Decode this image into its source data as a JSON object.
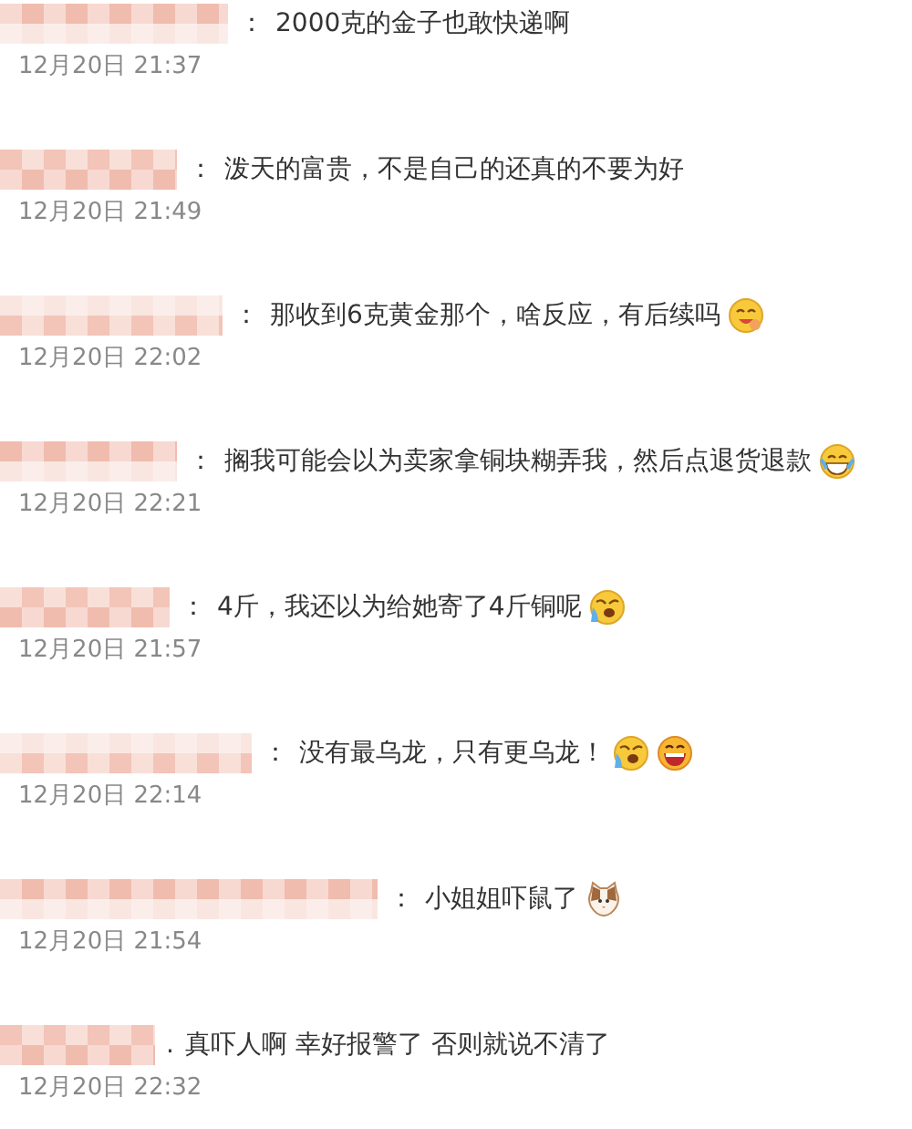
{
  "comments": [
    {
      "separator": "：",
      "text": "2000克的金子也敢快递啊",
      "time": "12月20日 21:37"
    },
    {
      "separator": "：",
      "text": "泼天的富贵，不是自己的还真的不要为好",
      "time": "12月20日 21:49"
    },
    {
      "separator": "：",
      "text": "那收到6克黄金那个，啥反应，有后续吗",
      "emojis": [
        {
          "kind": "yummy"
        }
      ],
      "time": "12月20日 22:02"
    },
    {
      "separator": "：",
      "text": "搁我可能会以为卖家拿铜块糊弄我，然后点退货退款",
      "emojis": [
        {
          "kind": "laughtears"
        }
      ],
      "time": "12月20日 22:21"
    },
    {
      "separator": "：",
      "text": "4斤，我还以为给她寄了4斤铜呢",
      "emojis": [
        {
          "kind": "sob"
        }
      ],
      "time": "12月20日 21:57"
    },
    {
      "separator": "：",
      "text": "没有最乌龙，只有更乌龙！",
      "emojis": [
        {
          "kind": "sob"
        },
        {
          "kind": "laugh"
        }
      ],
      "time": "12月20日 22:14"
    },
    {
      "separator": "：",
      "text": "小姐姐吓鼠了",
      "emojis": [
        {
          "kind": "cat"
        }
      ],
      "time": "12月20日 21:54"
    },
    {
      "separator": ".",
      "text": "真吓人啊 幸好报警了 否则就说不清了",
      "time": "12月20日 22:32"
    }
  ]
}
